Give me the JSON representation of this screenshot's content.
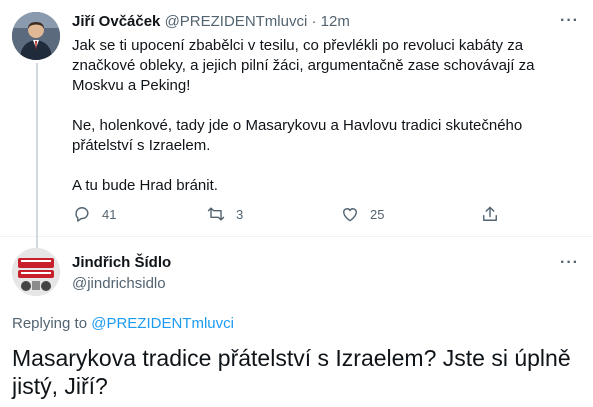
{
  "tweet": {
    "author_name": "Jiří Ovčáček",
    "author_handle": "@PREZIDENTmluvci",
    "separator": "·",
    "time": "12m",
    "paragraphs": [
      "Jak se ti upocení zbabělci v tesilu, co převlékli po revoluci kabáty za značkové obleky, a jejich pilní žáci, argumentačně zase schovávají za Moskvu a Peking!",
      "Ne, holenkové, tady jde o Masarykovu a Havlovu tradici skutečného přátelství s Izraelem.",
      "A tu bude Hrad bránit."
    ],
    "replies": "41",
    "retweets": "3",
    "likes": "25",
    "avatar_icon": "person-photo-icon"
  },
  "reply": {
    "author_name": "Jindřich Šídlo",
    "author_handle": "@jindrichsidlo",
    "replying_prefix": "Replying to ",
    "replying_handle": "@PREZIDENTmluvci",
    "text": "Masarykova tradice přátelství s Izraelem? Jste si úplně jistý, Jiří?",
    "avatar_icon": "show-logo-icon"
  },
  "more_icon": "more-options-icon",
  "colors": {
    "accent": "#1d9bf0",
    "muted": "#536471",
    "text": "#0f1419"
  }
}
